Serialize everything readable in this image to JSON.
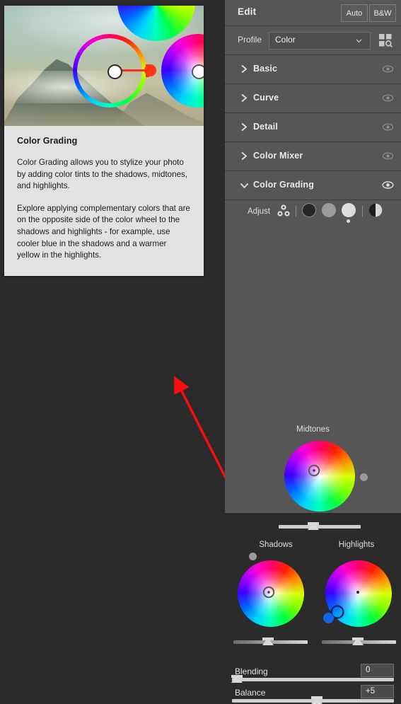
{
  "app": {
    "background_color": "#2b2b2b",
    "panel_color": "#565656"
  },
  "help_card": {
    "title": "Color Grading",
    "paragraphs": [
      "Color Grading allows you to stylize your photo by adding color tints to the shadows, midtones, and highlights.",
      "Explore applying complementary colors that are on the opposite side of the color wheel to the shadows and highlights - for example, use cooler blue in the shadows and a warmer yellow in the highlights."
    ],
    "illustration": {
      "name": "mountain-photo-with-color-wheels",
      "accent_color": "#ff3515"
    }
  },
  "annotation": {
    "arrow_color": "#fb0d0d",
    "from": "330,697",
    "to": "248,538"
  },
  "panel": {
    "header": {
      "title": "Edit",
      "auto_label": "Auto",
      "bw_label": "B&W"
    },
    "profile": {
      "label": "Profile",
      "value": "Color",
      "placeholder": "Color",
      "browser_icon": "profile-grid-search-icon"
    },
    "sections": [
      {
        "label": "Basic",
        "expanded": false,
        "eye": "eye-icon"
      },
      {
        "label": "Curve",
        "expanded": false,
        "eye": "eye-icon"
      },
      {
        "label": "Detail",
        "expanded": false,
        "eye": "eye-icon"
      },
      {
        "label": "Color Mixer",
        "expanded": false,
        "eye": "eye-icon"
      },
      {
        "label": "Color Grading",
        "expanded": true,
        "eye": "eye-icon"
      }
    ],
    "color_grading": {
      "adjust_label": "Adjust",
      "tone_buttons": [
        {
          "name": "all-tones",
          "icon": "three-circles-icon",
          "selected": false
        },
        {
          "name": "shadows",
          "icon": "dark-circle-icon",
          "selected": false,
          "color": "#262626"
        },
        {
          "name": "midtones",
          "icon": "mid-circle-icon",
          "selected": false,
          "color": "#9a9a9a"
        },
        {
          "name": "highlights",
          "icon": "light-circle-icon",
          "selected": true,
          "color": "#dcdcdc"
        },
        {
          "name": "global",
          "icon": "half-circle-icon",
          "selected": false
        }
      ],
      "wheels": [
        {
          "label": "Midtones",
          "luminance": 50
        },
        {
          "label": "Shadows",
          "luminance": 48
        },
        {
          "label": "Highlights",
          "luminance": 56
        }
      ],
      "blending": {
        "label": "Blending",
        "value": "0",
        "slider_percent": 0
      },
      "balance": {
        "label": "Balance",
        "value": "+5",
        "slider_percent": 53
      }
    }
  }
}
